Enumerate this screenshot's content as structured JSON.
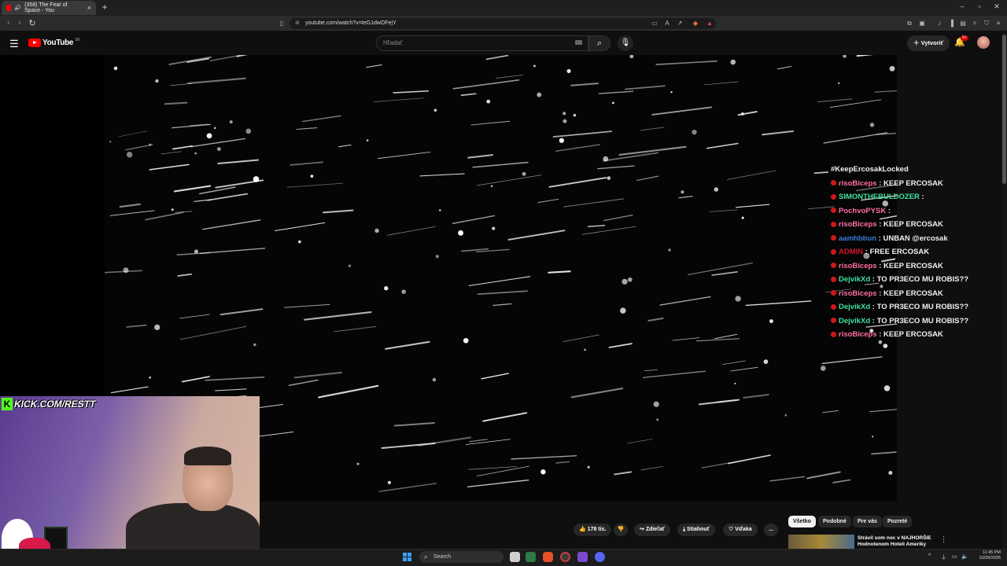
{
  "browser": {
    "tab_title": "(358) The Fear of Space - You",
    "url": "youtube.com/watch?v=teG1dwOFejY"
  },
  "youtube": {
    "logo_text": "YouTube",
    "region_code": "SK",
    "search_placeholder": "Hľadať",
    "create_label": "Vytvoriť",
    "notif_count": "9+"
  },
  "chat": {
    "header": "#KeepErcosakLocked",
    "messages": [
      {
        "user": "risoBiceps",
        "color": "#ff6fa0",
        "text": "KEEP ERCOSAK"
      },
      {
        "user": "SIMONTHEBULDOZER",
        "color": "#3ee0a0",
        "text": ""
      },
      {
        "user": "PochvoPYSK",
        "color": "#ff6fa0",
        "text": ""
      },
      {
        "user": "risoBiceps",
        "color": "#ff6fa0",
        "text": "KEEP ERCOSAK"
      },
      {
        "user": "aamhbbun",
        "color": "#3a7bd5",
        "text": "UNBAN @ercosak"
      },
      {
        "user": "ADMIN",
        "color": "#d4142a",
        "text": "FREE ERCOSAK"
      },
      {
        "user": "risoBiceps",
        "color": "#ff6fa0",
        "text": "KEEP ERCOSAK"
      },
      {
        "user": "DejvikXd",
        "color": "#3ee0a0",
        "text": "TO PR3ECO MU ROBIS??"
      },
      {
        "user": "risoBiceps",
        "color": "#ff6fa0",
        "text": "KEEP ERCOSAK"
      },
      {
        "user": "DejvikXd",
        "color": "#3ee0a0",
        "text": "TO PR3ECO MU ROBIS??"
      },
      {
        "user": "DejvikXd",
        "color": "#3ee0a0",
        "text": "TO PR3ECO MU ROBIS??"
      },
      {
        "user": "risoBiceps",
        "color": "#ff6fa0",
        "text": "KEEP ERCOSAK"
      }
    ]
  },
  "overlay": {
    "kick_logo": "K",
    "kick_text": "KICK.COM/RESTT"
  },
  "actions": {
    "likes": "178 tis.",
    "share": "Zdieľať",
    "download": "Stiahnuť",
    "thanks": "Vďaka",
    "more": "..."
  },
  "chips": [
    "Všetko",
    "Podobné",
    "Pre vás",
    "Pozreté"
  ],
  "recommendation": {
    "title": "Strávil som noc v NAJHORŠIE Hodnotenom Hoteli Ameriky"
  },
  "taskbar": {
    "search_label": "Search",
    "time": "11:45 PM",
    "date": "10/29/2025"
  }
}
